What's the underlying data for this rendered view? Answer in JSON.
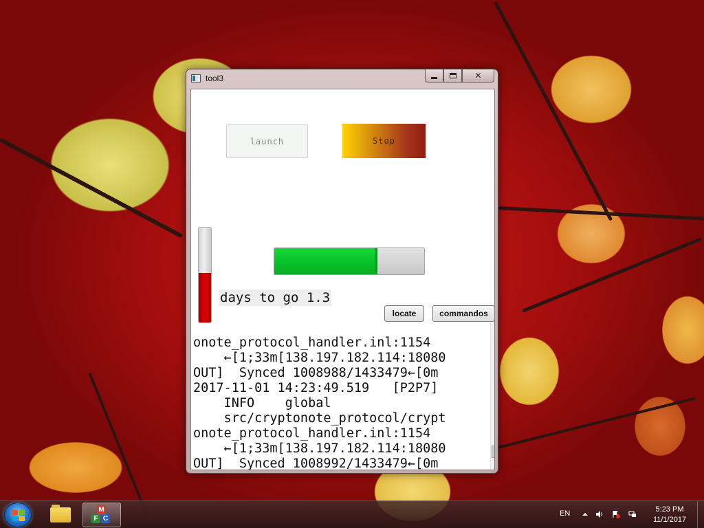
{
  "window": {
    "title": "tool3",
    "launch_label": "launch",
    "stop_label": "Stop",
    "vertical_progress": 0.52,
    "horizontal_progress": 0.69,
    "days_label": "days to go 1.3",
    "locate_label": "locate",
    "commandos_label": "commandos",
    "log_lines": [
      "onote_protocol_handler.inl:1154",
      "    ←[1;33m[138.197.182.114:18080",
      "OUT]  Synced 1008988/1433479←[0m",
      "2017-11-01 14:23:49.519   [P2P7]",
      "    INFO    global",
      "    src/cryptonote_protocol/crypt",
      "onote_protocol_handler.inl:1154",
      "    ←[1;33m[138.197.182.114:18080",
      "OUT]  Synced 1008992/1433479←[0m"
    ]
  },
  "taskbar": {
    "language": "EN",
    "time": "5:23 PM",
    "date": "11/1/2017",
    "icons": [
      "start-orb-icon",
      "explorer-folder-icon",
      "app-mfc-icon"
    ],
    "tray_icons": [
      "show-hidden-icon",
      "volume-icon",
      "action-center-flag-icon",
      "network-icon"
    ]
  },
  "colors": {
    "stop_gradient_start": "#ffd400",
    "stop_gradient_end": "#8e1c15",
    "vbar_fill": "#e00000",
    "hbar_fill": "#08c42a"
  }
}
